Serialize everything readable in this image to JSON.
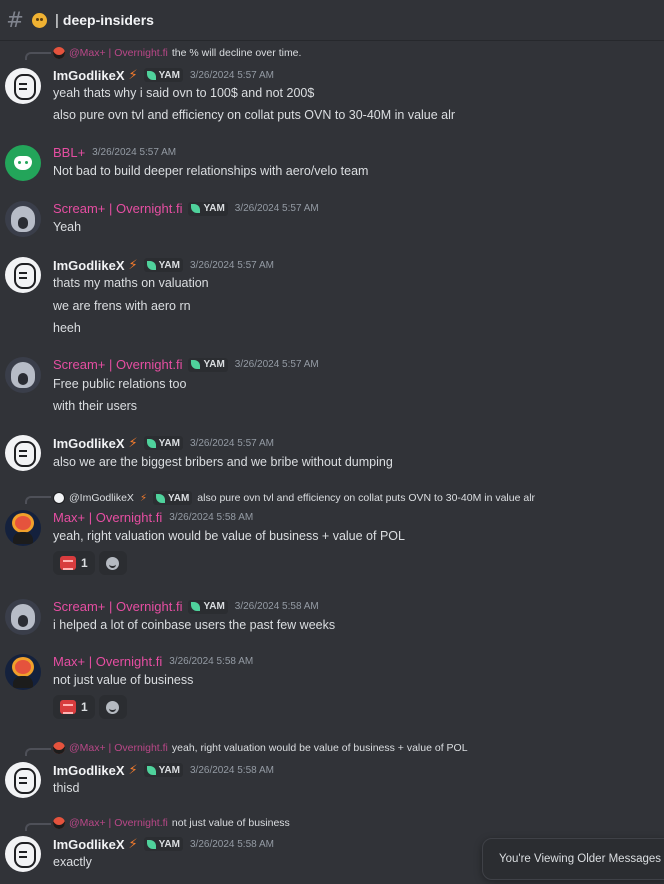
{
  "header": {
    "hash": "#",
    "icon": "hushed-face-emoji",
    "separator": "|",
    "channel": "deep-insiders"
  },
  "role_tag": "YAM",
  "messages": [
    {
      "reply": {
        "author": "@Max+ | Overnight.fi",
        "text": "the % will decline over time."
      },
      "author": "ImGodlikeX",
      "timestamp": "3/26/2024 5:57 AM",
      "lines": [
        "yeah thats why i said ovn to 100$ and not 200$",
        "also pure ovn tvl and efficiency on collat puts OVN to 30-40M in value alr"
      ]
    },
    {
      "author": "BBL+",
      "timestamp": "3/26/2024 5:57 AM",
      "lines": [
        "Not bad to build deeper relationships with aero/velo team"
      ]
    },
    {
      "author": "Scream+ | Overnight.fi",
      "timestamp": "3/26/2024 5:57 AM",
      "lines": [
        "Yeah"
      ]
    },
    {
      "author": "ImGodlikeX",
      "timestamp": "3/26/2024 5:57 AM",
      "lines": [
        "thats my maths on valuation",
        "we are frens with aero rn",
        "heeh"
      ]
    },
    {
      "author": "Scream+ | Overnight.fi",
      "timestamp": "3/26/2024 5:57 AM",
      "lines": [
        "Free public relations too",
        "with their users"
      ]
    },
    {
      "author": "ImGodlikeX",
      "timestamp": "3/26/2024 5:57 AM",
      "lines": [
        "also we are the biggest bribers and we bribe without dumping"
      ]
    },
    {
      "reply": {
        "author": "@ImGodlikeX",
        "text": "also pure ovn tvl and efficiency on collat puts OVN to 30-40M in value alr"
      },
      "author": "Max+ | Overnight.fi",
      "timestamp": "3/26/2024 5:58 AM",
      "lines": [
        "yeah, right valuation would be value of business + value of POL"
      ],
      "reaction_count": "1"
    },
    {
      "author": "Scream+ | Overnight.fi",
      "timestamp": "3/26/2024 5:58 AM",
      "lines": [
        "i helped a lot of coinbase users the past few weeks"
      ]
    },
    {
      "author": "Max+ | Overnight.fi",
      "timestamp": "3/26/2024 5:58 AM",
      "lines": [
        "not just value of business"
      ],
      "reaction_count": "1"
    },
    {
      "reply": {
        "author": "@Max+ | Overnight.fi",
        "text": "yeah, right valuation would be value of business + value of POL"
      },
      "author": "ImGodlikeX",
      "timestamp": "3/26/2024 5:58 AM",
      "lines": [
        "thisd"
      ]
    },
    {
      "reply": {
        "author": "@Max+ | Overnight.fi",
        "text": "not just value of business"
      },
      "author": "ImGodlikeX",
      "timestamp": "3/26/2024 5:58 AM",
      "lines": [
        "exactly"
      ]
    }
  ],
  "older_messages_banner": "You're Viewing Older Messages",
  "colors": {
    "background": "#313338",
    "role_pink": "#e64ea2",
    "yam_leaf": "#4fd29c",
    "bolt": "#f47b2c"
  }
}
